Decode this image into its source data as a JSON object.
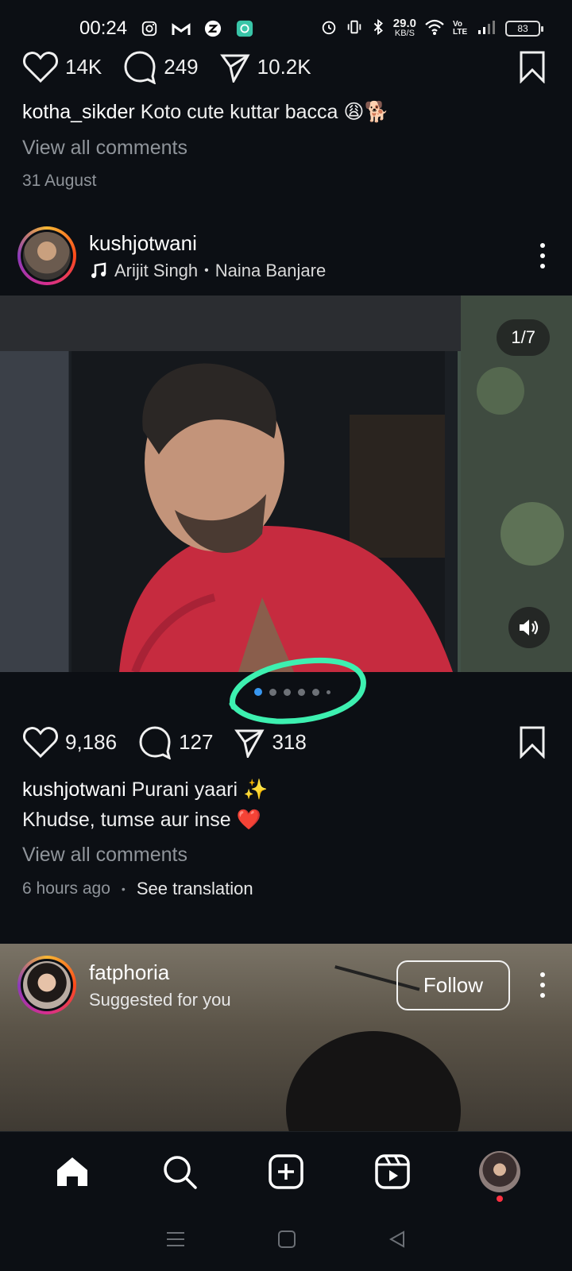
{
  "status_bar": {
    "time": "00:24",
    "net_speed": "29.0",
    "net_unit": "KB/S",
    "volte": "Vo LTE",
    "battery": "83"
  },
  "prev_post": {
    "likes": "14K",
    "comments": "249",
    "shares": "10.2K",
    "caption_user": "kotha_sikder",
    "caption_text": "Koto cute kuttar bacca 😩🐕",
    "view_comments": "View all comments",
    "date": "31 August"
  },
  "post": {
    "username": "kushjotwani",
    "audio_artist": "Arijit Singh",
    "audio_sep": "•",
    "audio_title": "Naina Banjare",
    "slide_counter": "1/7",
    "likes": "9,186",
    "comments": "127",
    "shares": "318",
    "caption_user": "kushjotwani",
    "caption_line1": "Purani yaari ✨",
    "caption_line2": "Khudse, tumse aur inse ❤️",
    "view_comments": "View all comments",
    "time": "6 hours ago",
    "time_sep": "•",
    "see_translation": "See translation",
    "carousel_index": 1,
    "carousel_total": 7
  },
  "suggested": {
    "username": "fatphoria",
    "subtitle": "Suggested for you",
    "follow_label": "Follow"
  },
  "colors": {
    "background": "#0c0f14",
    "active_dot": "#3897f0",
    "highlight": "#3df0b0",
    "notif": "#ff3040"
  }
}
